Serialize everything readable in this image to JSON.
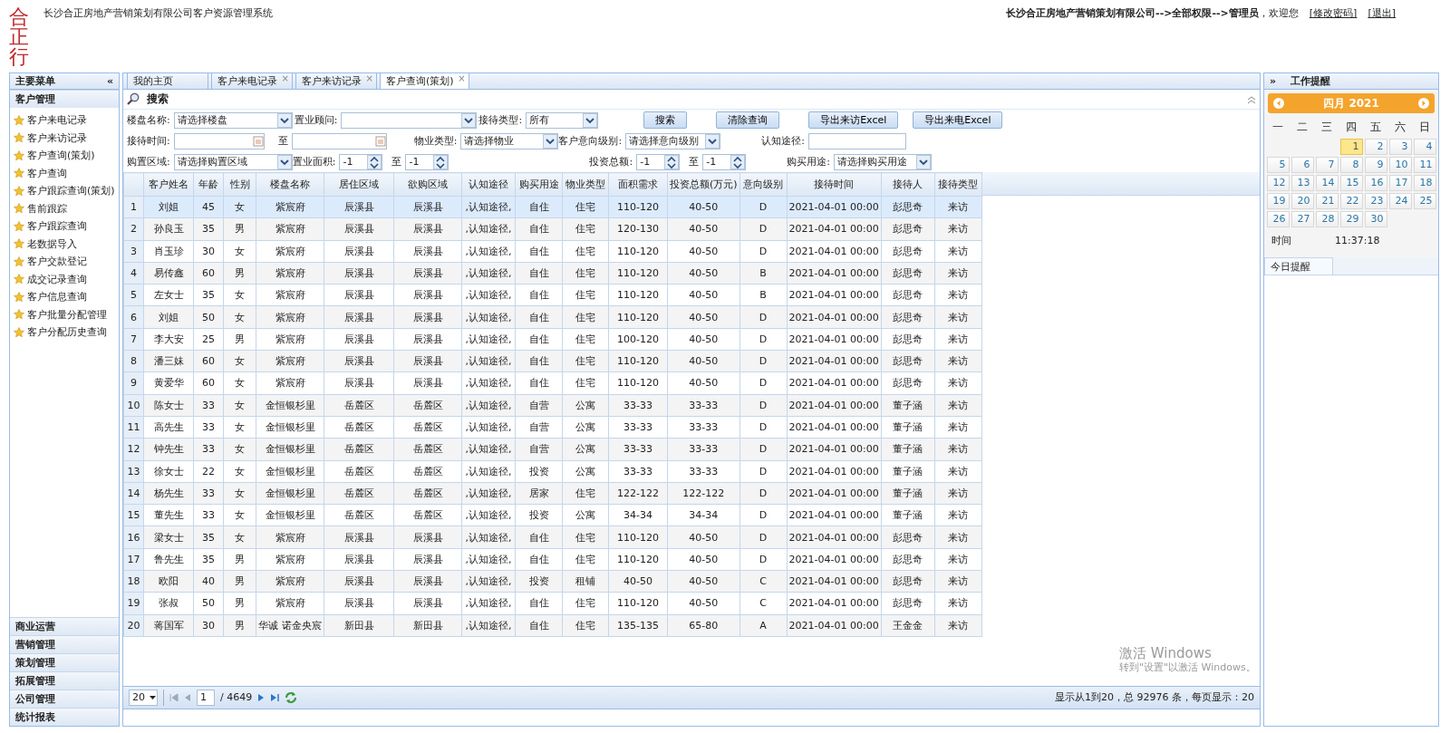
{
  "header": {
    "title": "长沙合正房地产营销策划有限公司客户资源管理系统",
    "logo_text": "合正行",
    "user_info": "**长沙合正房地产营销策划有限公司-->全部权限-->管理员**，欢迎您",
    "links": [
      "[修改密码]",
      "[退出]"
    ]
  },
  "sidebar": {
    "title": "主要菜单",
    "collapse": "«",
    "sections": [
      {
        "title": "客户管理",
        "items": [
          "客户来电记录",
          "客户来访记录",
          "客户查询(策划)",
          "客户查询",
          "客户跟踪查询(策划)",
          "售前跟踪",
          "客户跟踪查询",
          "老数据导入",
          "客户交款登记",
          "成交记录查询",
          "客户信息查询",
          "客户批量分配管理",
          "客户分配历史查询"
        ]
      },
      {
        "title": "商业运营"
      },
      {
        "title": "营销管理"
      },
      {
        "title": "策划管理"
      },
      {
        "title": "拓展管理"
      },
      {
        "title": "公司管理"
      },
      {
        "title": "统计报表"
      }
    ]
  },
  "tabs": [
    {
      "label": "我的主页",
      "selected": false
    },
    {
      "label": "客户来电记录",
      "close": "×",
      "selected": false
    },
    {
      "label": "客户来访记录",
      "close": "×",
      "selected": false
    },
    {
      "label": "客户查询(策划)",
      "close": "×",
      "selected": true
    }
  ],
  "search": {
    "title": "搜索",
    "rows": [
      [
        {
          "kind": "select",
          "label": "楼盘名称:",
          "value": "请选择楼盘"
        },
        {
          "kind": "select",
          "label": "置业顾问:"
        },
        {
          "kind": "select",
          "label": "接待类型:",
          "value": "所有"
        },
        {
          "kind": "button",
          "label": "搜索"
        },
        {
          "kind": "button",
          "label": "清除查询"
        },
        {
          "kind": "button",
          "label": "导出来访Excel"
        },
        {
          "kind": "button",
          "label": "导出来电Excel"
        }
      ],
      [
        {
          "kind": "date",
          "label": "接待时间:"
        },
        {
          "kind": "date",
          "label": "至"
        },
        {
          "kind": "select",
          "label": "物业类型:",
          "value": "请选择物业"
        },
        {
          "kind": "select",
          "label": "客户意向级别:",
          "value": "请选择意向级别"
        },
        {
          "kind": "text",
          "label": "认知途径:"
        }
      ],
      [
        {
          "kind": "select",
          "label": "购置区域:",
          "value": "请选择购置区域"
        },
        {
          "kind": "spin",
          "label": "置业面积:",
          "value": "-1"
        },
        {
          "kind": "spin",
          "label": "至",
          "value": "-1"
        },
        {
          "kind": "spin",
          "label": "投资总额:",
          "value": "-1"
        },
        {
          "kind": "spin",
          "label": "至",
          "value": "-1"
        },
        {
          "kind": "select",
          "label": "购买用途:",
          "value": "请选择购买用途"
        }
      ]
    ]
  },
  "table": {
    "columns": [
      "",
      "客户姓名",
      "年龄",
      "性别",
      "楼盘名称",
      "居住区域",
      "欲购区域",
      "认知途径",
      "购买用途",
      "物业类型",
      "面积需求",
      "投资总额(万元)",
      "意向级别",
      "接待时间",
      "接待人",
      "接待类型"
    ],
    "rows": [
      {
        "selected": true,
        "cells": [
          "1",
          "刘姐",
          "45",
          "女",
          "紫宸府",
          "辰溪县",
          "辰溪县",
          ",认知途径,",
          "自住",
          "住宅",
          "110-120",
          "40-50",
          "D",
          "2021-04-01 00:00",
          "彭思奇",
          "来访"
        ]
      },
      {
        "selected": false,
        "cells": [
          "2",
          "孙良玉",
          "35",
          "男",
          "紫宸府",
          "辰溪县",
          "辰溪县",
          ",认知途径,",
          "自住",
          "住宅",
          "120-130",
          "40-50",
          "D",
          "2021-04-01 00:00",
          "彭思奇",
          "来访"
        ]
      },
      {
        "selected": false,
        "cells": [
          "3",
          "肖玉珍",
          "30",
          "女",
          "紫宸府",
          "辰溪县",
          "辰溪县",
          ",认知途径,",
          "自住",
          "住宅",
          "110-120",
          "40-50",
          "D",
          "2021-04-01 00:00",
          "彭思奇",
          "来访"
        ]
      },
      {
        "selected": false,
        "cells": [
          "4",
          "易传鑫",
          "60",
          "男",
          "紫宸府",
          "辰溪县",
          "辰溪县",
          ",认知途径,",
          "自住",
          "住宅",
          "110-120",
          "40-50",
          "B",
          "2021-04-01 00:00",
          "彭思奇",
          "来访"
        ]
      },
      {
        "selected": false,
        "cells": [
          "5",
          "左女士",
          "35",
          "女",
          "紫宸府",
          "辰溪县",
          "辰溪县",
          ",认知途径,",
          "自住",
          "住宅",
          "110-120",
          "40-50",
          "B",
          "2021-04-01 00:00",
          "彭思奇",
          "来访"
        ]
      },
      {
        "selected": false,
        "cells": [
          "6",
          "刘姐",
          "50",
          "女",
          "紫宸府",
          "辰溪县",
          "辰溪县",
          ",认知途径,",
          "自住",
          "住宅",
          "110-120",
          "40-50",
          "D",
          "2021-04-01 00:00",
          "彭思奇",
          "来访"
        ]
      },
      {
        "selected": false,
        "cells": [
          "7",
          "李大安",
          "25",
          "男",
          "紫宸府",
          "辰溪县",
          "辰溪县",
          ",认知途径,",
          "自住",
          "住宅",
          "100-120",
          "40-50",
          "D",
          "2021-04-01 00:00",
          "彭思奇",
          "来访"
        ]
      },
      {
        "selected": false,
        "cells": [
          "8",
          "潘三妹",
          "60",
          "女",
          "紫宸府",
          "辰溪县",
          "辰溪县",
          ",认知途径,",
          "自住",
          "住宅",
          "110-120",
          "40-50",
          "D",
          "2021-04-01 00:00",
          "彭思奇",
          "来访"
        ]
      },
      {
        "selected": false,
        "cells": [
          "9",
          "黄爱华",
          "60",
          "女",
          "紫宸府",
          "辰溪县",
          "辰溪县",
          ",认知途径,",
          "自住",
          "住宅",
          "110-120",
          "40-50",
          "D",
          "2021-04-01 00:00",
          "彭思奇",
          "来访"
        ]
      },
      {
        "selected": false,
        "cells": [
          "10",
          "陈女士",
          "33",
          "女",
          "金恒银杉里",
          "岳麓区",
          "岳麓区",
          ",认知途径,",
          "自营",
          "公寓",
          "33-33",
          "33-33",
          "D",
          "2021-04-01 00:00",
          "董子涵",
          "来访"
        ]
      },
      {
        "selected": false,
        "cells": [
          "11",
          "高先生",
          "33",
          "女",
          "金恒银杉里",
          "岳麓区",
          "岳麓区",
          ",认知途径,",
          "自营",
          "公寓",
          "33-33",
          "33-33",
          "D",
          "2021-04-01 00:00",
          "董子涵",
          "来访"
        ]
      },
      {
        "selected": false,
        "cells": [
          "12",
          "钟先生",
          "33",
          "女",
          "金恒银杉里",
          "岳麓区",
          "岳麓区",
          ",认知途径,",
          "自营",
          "公寓",
          "33-33",
          "33-33",
          "D",
          "2021-04-01 00:00",
          "董子涵",
          "来访"
        ]
      },
      {
        "selected": false,
        "cells": [
          "13",
          "徐女士",
          "22",
          "女",
          "金恒银杉里",
          "岳麓区",
          "岳麓区",
          ",认知途径,",
          "投资",
          "公寓",
          "33-33",
          "33-33",
          "D",
          "2021-04-01 00:00",
          "董子涵",
          "来访"
        ]
      },
      {
        "selected": false,
        "cells": [
          "14",
          "杨先生",
          "33",
          "女",
          "金恒银杉里",
          "岳麓区",
          "岳麓区",
          ",认知途径,",
          "居家",
          "住宅",
          "122-122",
          "122-122",
          "D",
          "2021-04-01 00:00",
          "董子涵",
          "来访"
        ]
      },
      {
        "selected": false,
        "cells": [
          "15",
          "董先生",
          "33",
          "女",
          "金恒银杉里",
          "岳麓区",
          "岳麓区",
          ",认知途径,",
          "投资",
          "公寓",
          "34-34",
          "34-34",
          "D",
          "2021-04-01 00:00",
          "董子涵",
          "来访"
        ]
      },
      {
        "selected": false,
        "cells": [
          "16",
          "梁女士",
          "35",
          "女",
          "紫宸府",
          "辰溪县",
          "辰溪县",
          ",认知途径,",
          "自住",
          "住宅",
          "110-120",
          "40-50",
          "D",
          "2021-04-01 00:00",
          "彭思奇",
          "来访"
        ]
      },
      {
        "selected": false,
        "cells": [
          "17",
          "鲁先生",
          "35",
          "男",
          "紫宸府",
          "辰溪县",
          "辰溪县",
          ",认知途径,",
          "自住",
          "住宅",
          "110-120",
          "40-50",
          "D",
          "2021-04-01 00:00",
          "彭思奇",
          "来访"
        ]
      },
      {
        "selected": false,
        "cells": [
          "18",
          "欧阳",
          "40",
          "男",
          "紫宸府",
          "辰溪县",
          "辰溪县",
          ",认知途径,",
          "投资",
          "租铺",
          "40-50",
          "40-50",
          "C",
          "2021-04-01 00:00",
          "彭思奇",
          "来访"
        ]
      },
      {
        "selected": false,
        "cells": [
          "19",
          "张叔",
          "50",
          "男",
          "紫宸府",
          "辰溪县",
          "辰溪县",
          ",认知途径,",
          "自住",
          "住宅",
          "110-120",
          "40-50",
          "C",
          "2021-04-01 00:00",
          "彭思奇",
          "来访"
        ]
      },
      {
        "selected": false,
        "cells": [
          "20",
          "蒋国军",
          "30",
          "男",
          "华诚 诺金央宸",
          "新田县",
          "新田县",
          ",认知途径,",
          "自住",
          "住宅",
          "135-135",
          "65-80",
          "A",
          "2021-04-01 00:00",
          "王金金",
          "来访"
        ]
      }
    ]
  },
  "pager": {
    "page_size": "20",
    "page": "1",
    "total_pages": "/ 4649",
    "summary": "显示从1到20，总 92976 条，每页显示：20"
  },
  "activation_notice": {
    "title": "激活 Windows",
    "text": "转到\"设置\"以激活 Windows。"
  },
  "reminder_panel": {
    "title": "工作提醒",
    "expand": "»",
    "calendar": {
      "month": "四月 2021",
      "weekdays": [
        "一",
        "二",
        "三",
        "四",
        "五",
        "六",
        "日"
      ],
      "days": [
        {
          "label": "1",
          "selected": true
        },
        {
          "label": "2",
          "selected": false
        },
        {
          "label": "3",
          "selected": false
        },
        {
          "label": "4",
          "selected": false
        },
        {
          "label": "5",
          "selected": false
        },
        {
          "label": "6",
          "selected": false
        },
        {
          "label": "7",
          "selected": false
        },
        {
          "label": "8",
          "selected": false
        },
        {
          "label": "9",
          "selected": false
        },
        {
          "label": "10",
          "selected": false
        },
        {
          "label": "11",
          "selected": false
        },
        {
          "label": "12",
          "selected": false
        },
        {
          "label": "13",
          "selected": false
        },
        {
          "label": "14",
          "selected": false
        },
        {
          "label": "15",
          "selected": false
        },
        {
          "label": "16",
          "selected": false
        },
        {
          "label": "17",
          "selected": false
        },
        {
          "label": "18",
          "selected": false
        },
        {
          "label": "19",
          "selected": false
        },
        {
          "label": "20",
          "selected": false
        },
        {
          "label": "21",
          "selected": false
        },
        {
          "label": "22",
          "selected": false
        },
        {
          "label": "23",
          "selected": false
        },
        {
          "label": "24",
          "selected": false
        },
        {
          "label": "25",
          "selected": false
        },
        {
          "label": "26",
          "selected": false
        },
        {
          "label": "27",
          "selected": false
        },
        {
          "label": "28",
          "selected": false
        },
        {
          "label": "29",
          "selected": false
        },
        {
          "label": "30",
          "selected": false
        }
      ]
    },
    "time_label": "时间",
    "time": "11:37:18",
    "today_tab": "今日提醒"
  }
}
